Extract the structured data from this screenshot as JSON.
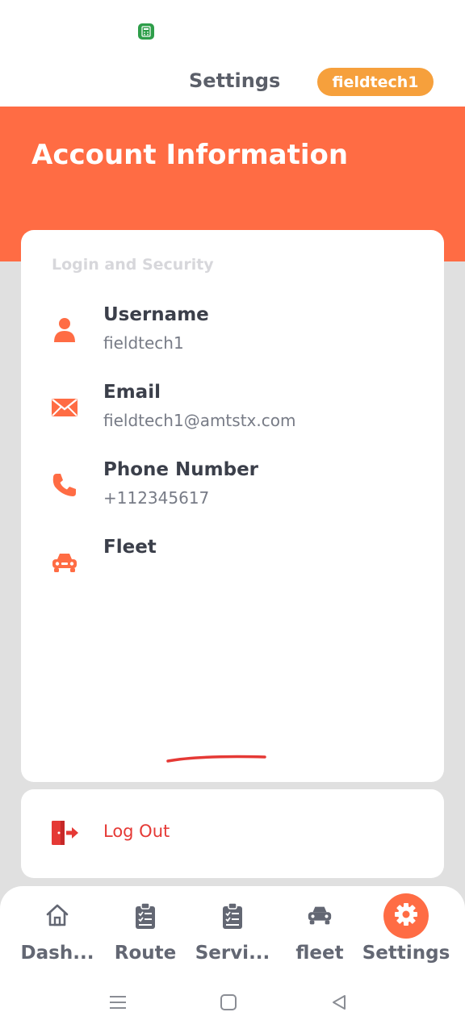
{
  "status_bar": {
    "app_icon": "calculator-app-icon"
  },
  "app_bar": {
    "title": "Settings",
    "user_badge": "fieldtech1"
  },
  "header": {
    "title": "Account Information"
  },
  "account": {
    "section_label": "Login and Security",
    "rows": [
      {
        "icon": "person-icon",
        "label": "Username",
        "value": "fieldtech1"
      },
      {
        "icon": "envelope-icon",
        "label": "Email",
        "value": "fieldtech1@amtstx.com"
      },
      {
        "icon": "phone-icon",
        "label": "Phone Number",
        "value": "+112345617"
      },
      {
        "icon": "car-icon",
        "label": "Fleet",
        "value": ""
      }
    ]
  },
  "logout": {
    "label": "Log Out",
    "icon": "logout-door-icon"
  },
  "bottom_nav": {
    "items": [
      {
        "label": "Dash...",
        "icon": "home-icon",
        "active": false
      },
      {
        "label": "Route",
        "icon": "clipboard-check-icon",
        "active": false
      },
      {
        "label": "Servi...",
        "icon": "clipboard-check-icon",
        "active": false
      },
      {
        "label": "fleet",
        "icon": "car-icon",
        "active": false
      },
      {
        "label": "Settings",
        "icon": "gear-icon",
        "active": true
      }
    ]
  },
  "system_nav": {
    "buttons": [
      "menu-icon",
      "home-square-icon",
      "back-triangle-icon"
    ]
  },
  "colors": {
    "accent": "#ff6c44",
    "badge": "#f6a03c",
    "logout": "#e53935",
    "background": "#e0e0e0",
    "text_primary": "#3b3f4a",
    "text_secondary": "#777b86"
  }
}
